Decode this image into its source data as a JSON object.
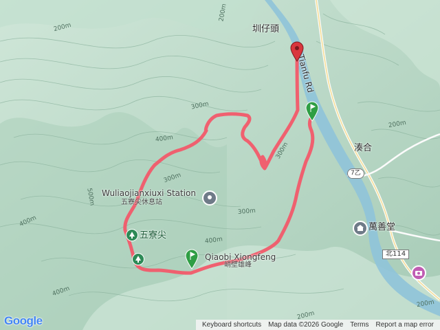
{
  "map": {
    "labels": {
      "zunzaitou": "圳仔頭",
      "tianfu_rd": "Tianfu Rd",
      "couhe": "湊合",
      "wuliaojian_station_en": "Wuliaojianxiuxi Station",
      "wuliaojian_station_zh": "五寮尖休息站",
      "wuliaojian_peak": "五寮尖",
      "qiaobi_en": "Qiaobi Xiongfeng",
      "qiaobi_zh": "峭壁雄峰",
      "wanshantang": "萬善堂",
      "route_7z": "7乙",
      "route_north114": "北114"
    },
    "contour_labels": [
      "200m",
      "200m",
      "200m",
      "300m",
      "300m",
      "300m",
      "300m",
      "400m",
      "400m",
      "400m",
      "400m",
      "500m",
      "200m",
      "200m"
    ],
    "colors": {
      "track": "#f25a6a",
      "pin_red": "#d9363e",
      "pin_green": "#2f9e44",
      "terrain": "#b9d9c8",
      "river": "#8fc3d9",
      "poi_green": "#2d8a56",
      "poi_gray": "#6f7b88"
    }
  },
  "footer": {
    "keyboard": "Keyboard shortcuts",
    "mapdata": "Map data ©2026 Google",
    "terms": "Terms",
    "report": "Report a map error"
  },
  "brand": {
    "logo": "Google"
  }
}
